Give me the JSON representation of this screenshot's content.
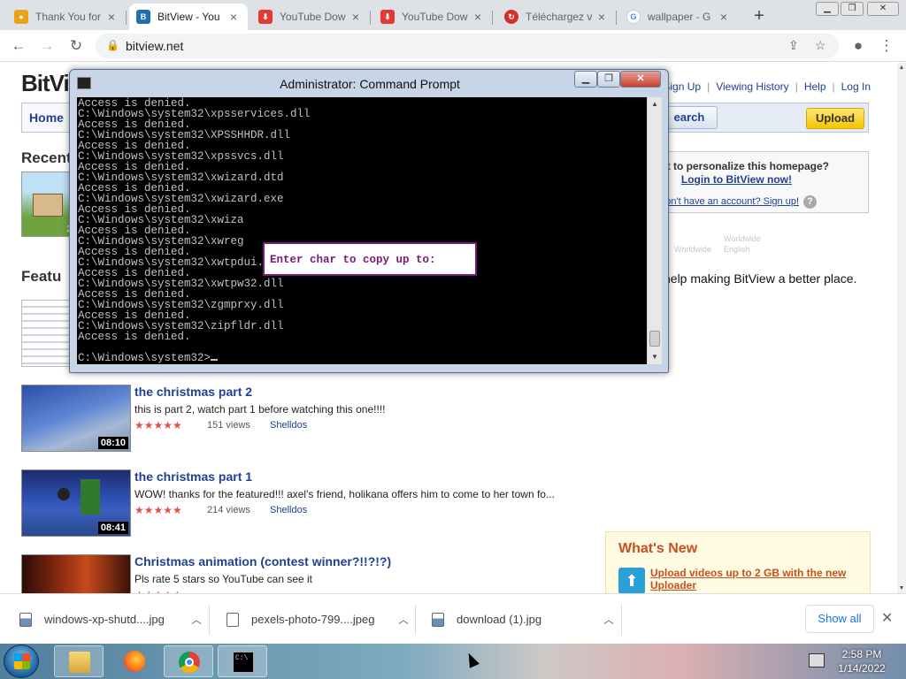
{
  "browser": {
    "tabs": [
      {
        "label": "Thank You for",
        "favicon": "cookie-icon",
        "color": "#e8a317",
        "active": false
      },
      {
        "label": "BitView - You",
        "favicon": "bitview-icon",
        "color": "#1f6fb5",
        "active": true
      },
      {
        "label": "YouTube Dow",
        "favicon": "youtube-download-icon",
        "color": "#e53935",
        "active": false
      },
      {
        "label": "YouTube Dow",
        "favicon": "youtube-download-icon",
        "color": "#e53935",
        "active": false
      },
      {
        "label": "Téléchargez v",
        "favicon": "download-icon",
        "color": "#d32f2f",
        "active": false
      },
      {
        "label": "wallpaper - G",
        "favicon": "google-icon",
        "color": "#4285f4",
        "active": false
      }
    ],
    "url": "bitview.net"
  },
  "site": {
    "logo": "BitVi",
    "top_links": [
      "Sign Up",
      "Viewing History",
      "Help",
      "Log In"
    ],
    "nav": {
      "home": "Home",
      "search": "earch",
      "upload": "Upload"
    },
    "recent_heading": "Recent",
    "recent_count": "2",
    "featured_heading": "Featu",
    "login_box": {
      "question": "t to personalize this homepage?",
      "login_link": "Login to BitView now!",
      "signup_link": "on't have an account? Sign up!",
      "help_icon": "?"
    },
    "faded_lines": [
      "Worldwide",
      "English"
    ],
    "help_line": "help making BitView a better place.",
    "videos": [
      {
        "title": "the christmas part 2",
        "desc": "this is part 2, watch part 1 before watching this one!!!!",
        "stars": "★★★★★",
        "views": "151 views",
        "user": "Shelldos",
        "duration": "08:10"
      },
      {
        "title": "the christmas part 1",
        "desc": "WOW! thanks for the featured!!! axel's friend, holikana offers him to come to her town fo...",
        "stars": "★★★★★",
        "views": "214 views",
        "user": "Shelldos",
        "duration": "08:41"
      },
      {
        "title": "Christmas animation (contest winner?!!?!?)",
        "desc": "Pls rate 5 stars so YouTube can see it",
        "stars": "★★★★★",
        "views": "",
        "user": "",
        "duration": ""
      }
    ],
    "whats_new": {
      "heading": "What's New",
      "link": "Upload videos up to 2 GB with the new Uploader"
    }
  },
  "cmd": {
    "title": "Administrator: Command Prompt",
    "lines": [
      "Access is denied.",
      "C:\\Windows\\system32\\xpsservices.dll",
      "Access is denied.",
      "C:\\Windows\\system32\\XPSSHHDR.dll",
      "Access is denied.",
      "C:\\Windows\\system32\\xpssvcs.dll",
      "Access is denied.",
      "C:\\Windows\\system32\\xwizard.dtd",
      "Access is denied.",
      "C:\\Windows\\system32\\xwizard.exe",
      "Access is denied.",
      "C:\\Windows\\system32\\xwiza",
      "Access is denied.",
      "C:\\Windows\\system32\\xwreg",
      "Access is denied.",
      "C:\\Windows\\system32\\xwtpdui.dll",
      "Access is denied.",
      "C:\\Windows\\system32\\xwtpw32.dll",
      "Access is denied.",
      "C:\\Windows\\system32\\zgmprxy.dll",
      "Access is denied.",
      "C:\\Windows\\system32\\zipfldr.dll",
      "Access is denied.",
      "",
      "C:\\Windows\\system32>"
    ],
    "dialog_prompt": "Enter char to copy up to:"
  },
  "downloads": {
    "items": [
      "windows-xp-shutd....jpg",
      "pexels-photo-799....jpeg",
      "download (1).jpg"
    ],
    "show_all": "Show all"
  },
  "taskbar": {
    "time": "2:58 PM",
    "date": "1/14/2022",
    "apps": [
      "file-explorer-icon",
      "firefox-icon",
      "chrome-icon",
      "cmd-icon"
    ]
  }
}
